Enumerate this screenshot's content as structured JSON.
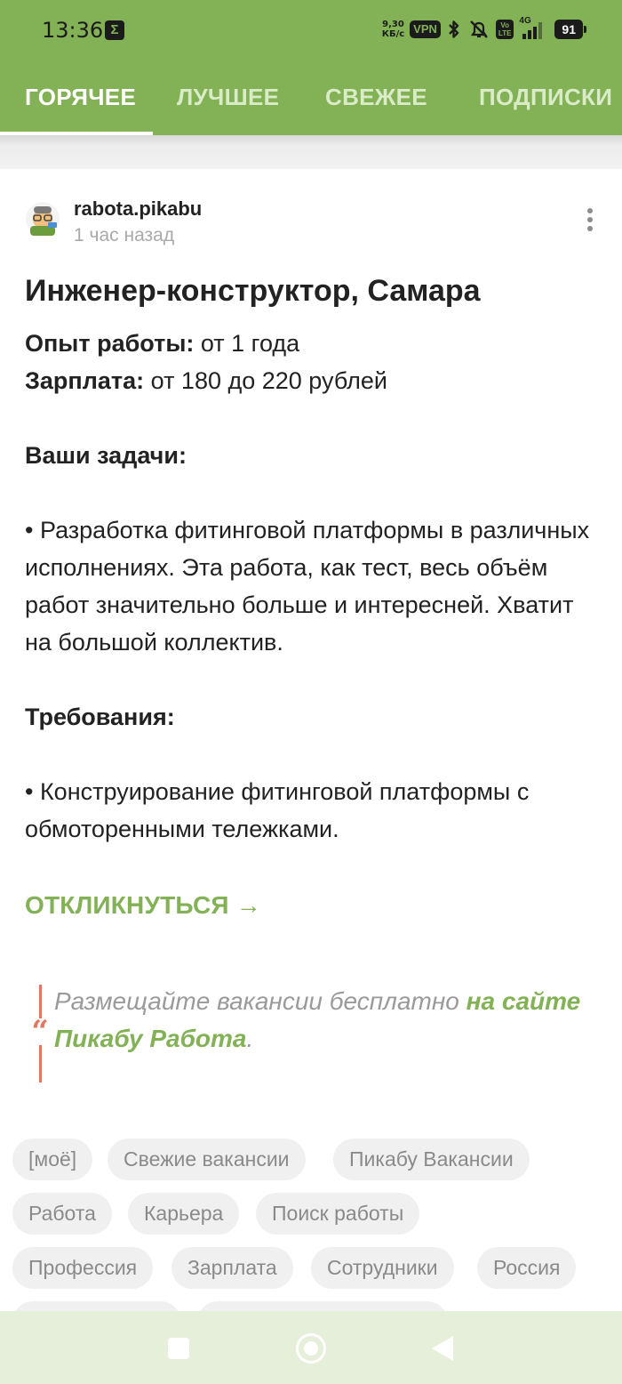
{
  "status_bar": {
    "time": "13:36",
    "speed_value": "9,30",
    "speed_unit": "КБ/с",
    "vpn": "VPN",
    "network": "4G",
    "battery": "91",
    "volte_top": "Vo",
    "volte_bottom": "LTE"
  },
  "tabs": [
    {
      "label": "ГОРЯЧЕЕ",
      "active": true
    },
    {
      "label": "ЛУЧШЕЕ",
      "active": false
    },
    {
      "label": "СВЕЖЕЕ",
      "active": false
    },
    {
      "label": "ПОДПИСКИ",
      "active": false
    }
  ],
  "post": {
    "author": "rabota.pikabu",
    "time": "1 час назад",
    "title": "Инженер-конструктор, Самара",
    "experience_label": "Опыт работы:",
    "experience_value": " от 1 года",
    "salary_label": "Зарплата:",
    "salary_value": " от 180 до 220 рублей",
    "tasks_heading": "Ваши задачи:",
    "tasks_text": "• Разработка фитинговой платформы в различных исполнениях. Эта работа, как тест, весь объём работ значительно больше и интересней. Хватит на большой коллектив.",
    "requirements_heading": "Требования:",
    "requirements_text": "• Конструирование фитинговой платформы с обмоторенными тележками.",
    "respond_label": "ОТКЛИКНУТЬСЯ →",
    "quote_text": "Размещайте вакансии бесплатно ",
    "quote_link": "на сайте Пикабу Работа",
    "quote_end": "."
  },
  "tags": [
    "[моё]",
    "Свежие вакансии",
    "Пикабу Вакансии",
    "Работа",
    "Карьера",
    "Поиск работы",
    "Профессия",
    "Зарплата",
    "Сотрудники",
    "Россия"
  ],
  "colors": {
    "brand_green": "#83b155",
    "quote_red": "#e07664",
    "nav_bg": "#e5efda"
  }
}
